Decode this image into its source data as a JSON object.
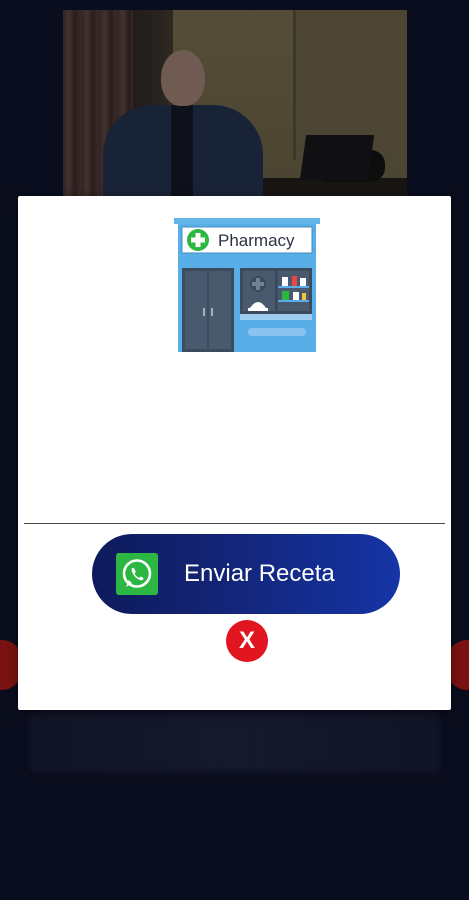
{
  "video": {
    "subject": "doctor-video-feed"
  },
  "modal": {
    "illustration": {
      "sign_text": "Pharmacy",
      "icon": "pharmacy-storefront-icon"
    },
    "send_button": {
      "label": "Enviar Receta",
      "icon": "whatsapp-icon"
    },
    "close_button": {
      "label": "X",
      "icon": "close-icon"
    }
  },
  "colors": {
    "background": "#0a0d1d",
    "button_gradient_start": "#0e1a5c",
    "button_gradient_end": "#1634a6",
    "whatsapp_green": "#2bb741",
    "close_red": "#e0151f",
    "pharmacy_blue": "#5aaee8"
  }
}
